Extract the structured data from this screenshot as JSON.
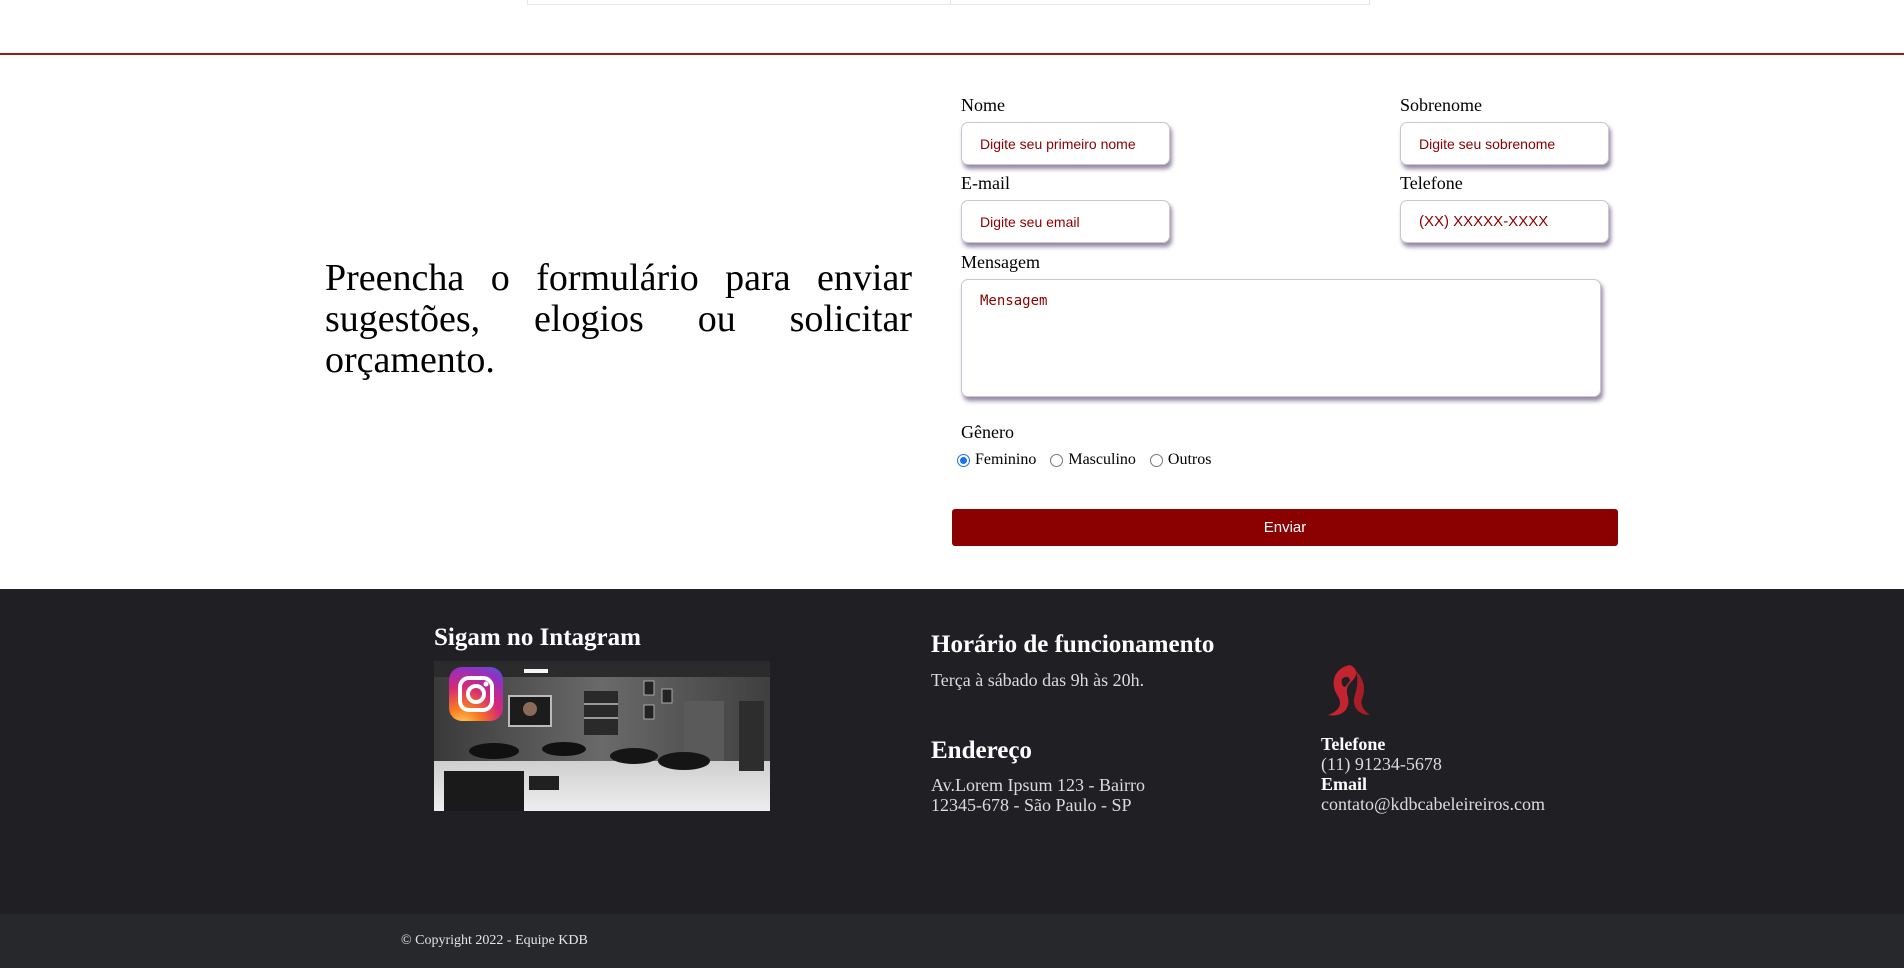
{
  "intro": {
    "text": "Preencha o formulário para enviar sugestões, elogios ou solicitar orçamento."
  },
  "form": {
    "nome": {
      "label": "Nome",
      "placeholder": "Digite seu primeiro nome"
    },
    "sobrenome": {
      "label": "Sobrenome",
      "placeholder": "Digite seu sobrenome"
    },
    "email": {
      "label": "E-mail",
      "placeholder": "Digite seu email"
    },
    "telefone": {
      "label": "Telefone",
      "placeholder": "(XX) XXXXX-XXXX"
    },
    "mensagem": {
      "label": "Mensagem",
      "placeholder": "Mensagem"
    },
    "genero": {
      "label": "Gênero",
      "options": [
        "Feminino",
        "Masculino",
        "Outros"
      ],
      "selected": "Feminino"
    },
    "submit_label": "Enviar"
  },
  "footer": {
    "instagram": {
      "title": "Sigam no Intagram",
      "icon": "instagram-icon"
    },
    "hours": {
      "title": "Horário de funcionamento",
      "text": "Terça à sábado das 9h às 20h."
    },
    "address": {
      "title": "Endereço",
      "line1": "Av.Lorem Ipsum 123 - Bairro",
      "line2": "12345-678 - São Paulo - SP"
    },
    "contact": {
      "logo": "woman-hair-logo-icon",
      "phone_label": "Telefone",
      "phone": "(11) 91234-5678",
      "email_label": "Email",
      "email": "contato@kdbcabeleireiros.com"
    },
    "copyright": "© Copyright 2022 - Equipe KDB"
  },
  "colors": {
    "accent": "#8b0000",
    "divider": "#9b1b1b",
    "footer_bg": "#1f1f24",
    "copyright_bg": "#27282c"
  }
}
